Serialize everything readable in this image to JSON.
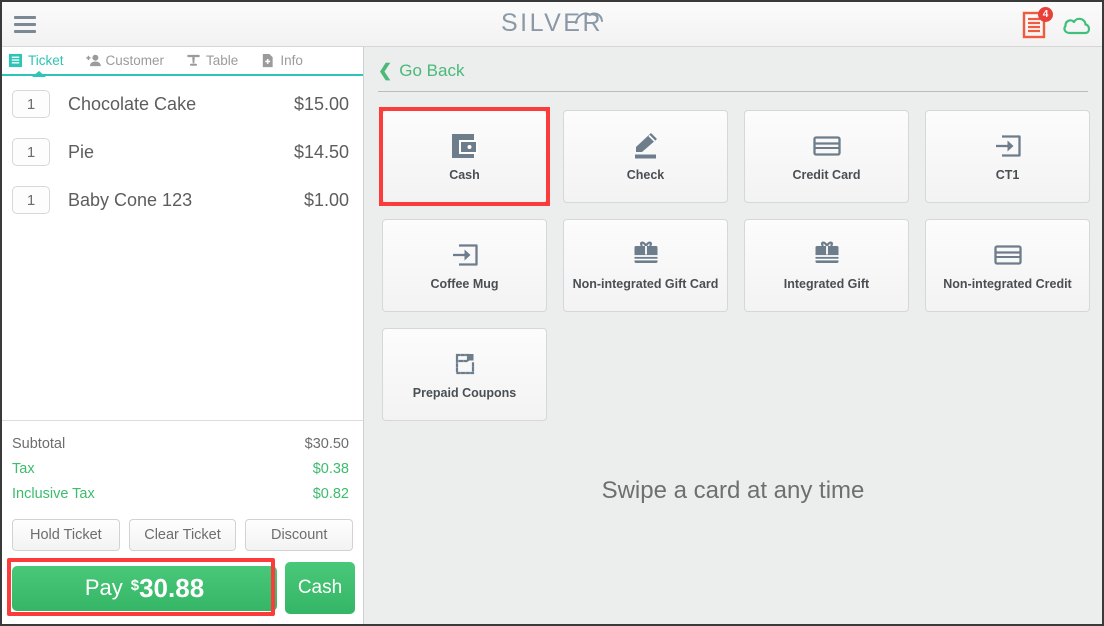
{
  "header": {
    "menu_label": "menu",
    "logo_text": "SILVER",
    "notification_count": "4",
    "receipt_icon": "receipt-icon",
    "cloud_icon": "cloud-icon"
  },
  "left_panel": {
    "tabs": [
      {
        "label": "Ticket",
        "icon": "receipt-icon",
        "active": true
      },
      {
        "label": "Customer",
        "icon": "add-person-icon",
        "active": false
      },
      {
        "label": "Table",
        "icon": "table-icon",
        "active": false
      },
      {
        "label": "Info",
        "icon": "document-plus-icon",
        "active": false
      }
    ],
    "items": [
      {
        "qty": "1",
        "name": "Chocolate Cake",
        "price": "$15.00"
      },
      {
        "qty": "1",
        "name": "Pie",
        "price": "$14.50"
      },
      {
        "qty": "1",
        "name": "Baby Cone 123",
        "price": "$1.00"
      }
    ],
    "totals": [
      {
        "label": "Subtotal",
        "value": "$30.50",
        "green": false
      },
      {
        "label": "Tax",
        "value": "$0.38",
        "green": true
      },
      {
        "label": "Inclusive Tax",
        "value": "$0.82",
        "green": true
      }
    ],
    "actions": [
      {
        "label": "Hold Ticket"
      },
      {
        "label": "Clear Ticket"
      },
      {
        "label": "Discount"
      }
    ],
    "pay": {
      "label": "Pay",
      "currency": "$",
      "amount": "30.88",
      "cash_label": "Cash",
      "highlighted": true
    }
  },
  "right_panel": {
    "go_back": "Go Back",
    "go_back_chevron": "chevron-left-icon",
    "tenders": [
      {
        "label": "Cash",
        "icon": "wallet-icon",
        "highlighted": true
      },
      {
        "label": "Check",
        "icon": "pen-signature-icon",
        "highlighted": false
      },
      {
        "label": "Credit Card",
        "icon": "credit-card-icon",
        "highlighted": false
      },
      {
        "label": "CT1",
        "icon": "arrow-into-box-icon",
        "highlighted": false
      },
      {
        "label": "Coffee Mug",
        "icon": "arrow-into-box-icon",
        "highlighted": false
      },
      {
        "label": "Non-integrated Gift Card",
        "icon": "gift-card-icon",
        "highlighted": false
      },
      {
        "label": "Integrated Gift",
        "icon": "gift-card-icon",
        "highlighted": false
      },
      {
        "label": "Non-integrated Credit",
        "icon": "credit-card-icon",
        "highlighted": false
      },
      {
        "label": "Prepaid Coupons",
        "icon": "coupon-icon",
        "highlighted": false
      }
    ],
    "swipe_message": "Swipe a card at any time"
  },
  "colors": {
    "accent_teal": "#2ec4b6",
    "green": "#3cbc6d",
    "highlight_red": "#fc3b3b",
    "icon_slate": "#6e7d8c",
    "logo_gray": "#8b99a6"
  }
}
